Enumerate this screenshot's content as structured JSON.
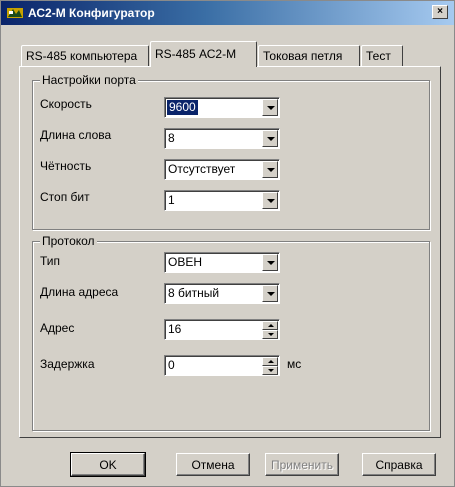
{
  "window": {
    "title": "АС2-М Конфигуратор",
    "close_glyph": "×"
  },
  "tabs": [
    {
      "label": "RS-485 компьютера",
      "active": false
    },
    {
      "label": "RS-485 АС2-М",
      "active": true
    },
    {
      "label": "Токовая петля",
      "active": false
    },
    {
      "label": "Тест",
      "active": false
    }
  ],
  "port_settings": {
    "title": "Настройки порта",
    "rows": [
      {
        "label": "Скорость",
        "value": "9600",
        "selected": true
      },
      {
        "label": "Длина слова",
        "value": "8"
      },
      {
        "label": "Чётность",
        "value": "Отсутствует"
      },
      {
        "label": "Стоп бит",
        "value": "1"
      }
    ]
  },
  "protocol": {
    "title": "Протокол",
    "type_label": "Тип",
    "type_value": "ОВЕН",
    "addr_len_label": "Длина адреса",
    "addr_len_value": "8 битный",
    "addr_label": "Адрес",
    "addr_value": "16",
    "delay_label": "Задержка",
    "delay_value": "0",
    "delay_unit": "мс"
  },
  "buttons": {
    "ok": "OK",
    "cancel": "Отмена",
    "apply": "Применить",
    "help": "Справка"
  }
}
